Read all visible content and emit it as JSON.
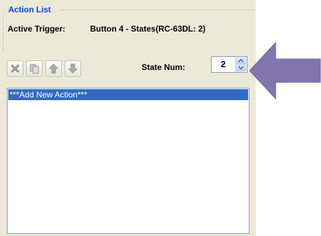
{
  "group": {
    "title": "Action List"
  },
  "trigger": {
    "label": "Active Trigger:",
    "value": "Button 4 - States(RC-63DL: 2)"
  },
  "toolbar": {
    "buttons": [
      {
        "icon": "delete-x-icon"
      },
      {
        "icon": "copy-icon"
      },
      {
        "icon": "move-up-arrow-icon"
      },
      {
        "icon": "move-down-arrow-icon"
      }
    ]
  },
  "state": {
    "label": "State Num:",
    "value": "2"
  },
  "actions": {
    "items": [
      "***Add New Action***"
    ]
  },
  "colors": {
    "accent": "#0046d5",
    "selection": "#316ac5",
    "callout_arrow": "#8177ae"
  }
}
